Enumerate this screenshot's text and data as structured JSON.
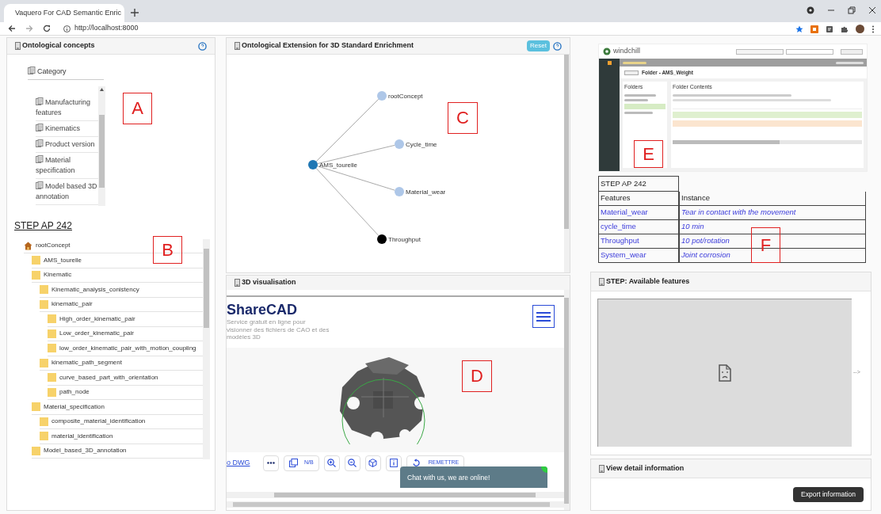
{
  "browser": {
    "tab_title": "Vaquero For CAD Semantic Enric",
    "url": "http://localhost:8000"
  },
  "concepts_panel": {
    "title": "Ontological concepts",
    "category_label": "Category",
    "categories": [
      "Manufacturing features",
      "Kinematics",
      "Product version",
      "Material specification",
      "Model based 3D annotation"
    ],
    "section_title": "STEP AP 242",
    "tree": [
      {
        "label": "rootConcept",
        "kind": "root",
        "children": [
          {
            "label": "AMS_tourelle",
            "kind": "folder"
          },
          {
            "label": "Kinematic",
            "kind": "folder",
            "children": [
              {
                "label": "Kinematic_analysis_conistency",
                "kind": "folder"
              },
              {
                "label": "kinematic_pair",
                "kind": "folder",
                "children": [
                  {
                    "label": "High_order_kinematic_pair",
                    "kind": "folder"
                  },
                  {
                    "label": "Low_order_kinematic_pair",
                    "kind": "folder"
                  },
                  {
                    "label": "low_order_kinematic_pair_with_motion_coupling",
                    "kind": "folder"
                  }
                ]
              },
              {
                "label": "kinematic_path_segment",
                "kind": "folder",
                "children": [
                  {
                    "label": "curve_based_part_with_orientation",
                    "kind": "folder"
                  },
                  {
                    "label": "path_node",
                    "kind": "folder"
                  }
                ]
              }
            ]
          },
          {
            "label": "Material_specification",
            "kind": "folder",
            "children": [
              {
                "label": "composite_material_identification",
                "kind": "folder"
              },
              {
                "label": "material_identification",
                "kind": "folder"
              }
            ]
          },
          {
            "label": "Model_based_3D_annotation",
            "kind": "folder"
          }
        ]
      }
    ]
  },
  "graph_panel": {
    "title": "Ontological Extension for 3D Standard Enrichment",
    "reset": "Reset",
    "nodes": [
      {
        "label": "AMS_tourelle",
        "color": "#1f77b4"
      },
      {
        "label": "rootConcept",
        "color": "#aec7e8"
      },
      {
        "label": "Cycle_time",
        "color": "#aec7e8"
      },
      {
        "label": "Material_wear",
        "color": "#aec7e8"
      },
      {
        "label": "Throughput",
        "color": "#000000"
      }
    ]
  },
  "viewer_panel": {
    "title": "3D visualisation",
    "site_title": "ShareCAD",
    "tagline": "Service gratuit en ligne pour visionner des fichiers de CAO et des modèles 3D",
    "link": "o DWG",
    "mode_button": "N/B",
    "reset_button": "REMETTRE",
    "chat": "Chat with us, we are online!"
  },
  "windchill": {
    "brand": "windchill",
    "folder_title": "Folder - AMS_Weight",
    "folders_label": "Folders",
    "contents_label": "Folder Contents"
  },
  "table": {
    "title": "STEP AP 242",
    "columns": [
      "Features",
      "Instance"
    ],
    "rows": [
      [
        "Material_wear",
        "Tear in contact with the movement"
      ],
      [
        "cycle_time",
        "10 min"
      ],
      [
        "Throughput",
        "10 pot/rotation"
      ],
      [
        "System_wear",
        "Joint corrosion"
      ]
    ]
  },
  "features_panel": {
    "title": "STEP: Available features",
    "trailing_text": "-->"
  },
  "detail_panel": {
    "title": "View detail information",
    "button": "Export information"
  },
  "annotations": [
    "A",
    "B",
    "C",
    "D",
    "E",
    "F"
  ]
}
